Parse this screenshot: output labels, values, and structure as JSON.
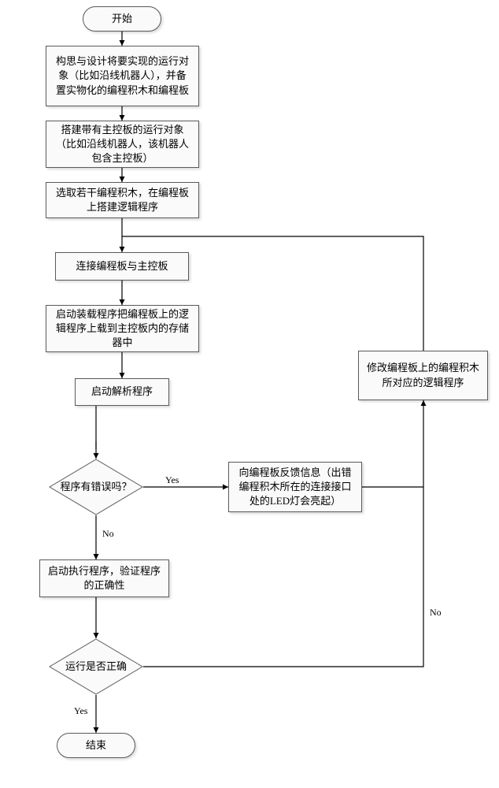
{
  "flow": {
    "start": "开始",
    "step1": "构思与设计将要实现的运行对象（比如沿线机器人），并备置实物化的编程积木和编程板",
    "step2": "搭建带有主控板的运行对象（比如沿线机器人，该机器人包含主控板）",
    "step3": "选取若干编程积木，在编程板上搭建逻辑程序",
    "step4": "连接编程板与主控板",
    "step5": "启动装载程序把编程板上的逻辑程序上载到主控板内的存储器中",
    "step6": "启动解析程序",
    "dec1": "程序有错误吗？",
    "dec1_yes": "Yes",
    "dec1_no": "No",
    "feedback": "向编程板反馈信息（出错编程积木所在的连接接口处的LED灯会亮起）",
    "modify": "修改编程板上的编程积木所对应的逻辑程序",
    "step7": "启动执行程序，验证程序的正确性",
    "dec2": "运行是否正确",
    "dec2_yes": "Yes",
    "dec2_no": "No",
    "end": "结束"
  }
}
